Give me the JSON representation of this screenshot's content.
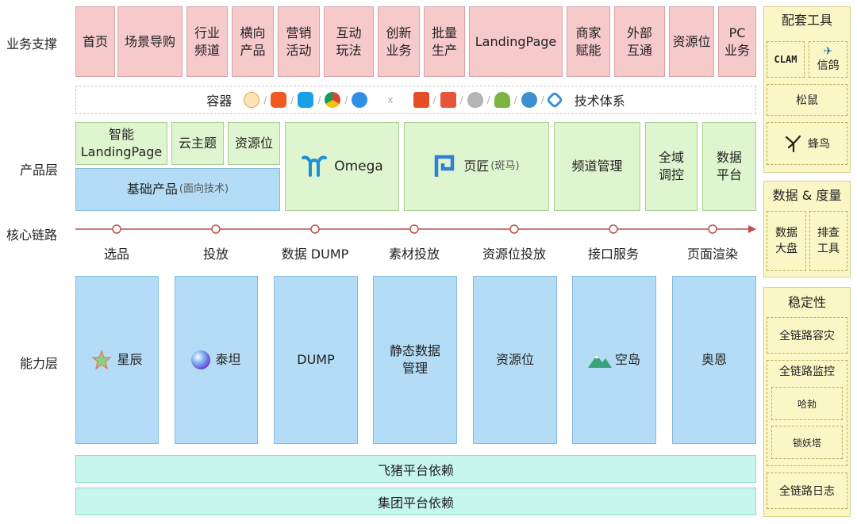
{
  "rows": {
    "business": "业务支撑",
    "product": "产品层",
    "core": "核心链路",
    "capability": "能力层"
  },
  "business_items": [
    "首页",
    "场景导购",
    "行业\n频道",
    "横向\n产品",
    "营销\n活动",
    "互动\n玩法",
    "创新\n业务",
    "批量\n生产",
    "LandingPage",
    "商家\n赋能",
    "外部\n互通",
    "资源位",
    "PC\n业务"
  ],
  "container": {
    "left_label": "容器",
    "right_label": "技术体系",
    "separator": "/",
    "x_mark": "x",
    "icons": [
      "feizhu-icon",
      "taobao-icon",
      "alipay-icon",
      "chrome-icon",
      "safari-icon",
      "html5-icon",
      "react-icon",
      "apple-icon",
      "android-icon",
      "miniapp-icon",
      "weex-icon"
    ]
  },
  "product": {
    "smart_landing": "智能\nLandingPage",
    "cloud_theme": "云主题",
    "resource_slot": "资源位",
    "base_product": "基础产品",
    "base_product_note": "(面向技术)",
    "omega": "Omega",
    "yejiang": "页匠",
    "yejiang_note": "(斑马)",
    "channel_mgmt": "频道管理",
    "global_control": "全域\n调控",
    "data_platform": "数据\n平台"
  },
  "core_steps": [
    "选品",
    "投放",
    "数据 DUMP",
    "素材投放",
    "资源位投放",
    "接口服务",
    "页面渲染"
  ],
  "capability": [
    {
      "label": "星辰",
      "icon": "star-icon"
    },
    {
      "label": "泰坦",
      "icon": "titan-icon"
    },
    {
      "label": "DUMP",
      "icon": ""
    },
    {
      "label": "静态数据\n管理",
      "icon": ""
    },
    {
      "label": "资源位",
      "icon": ""
    },
    {
      "label": "空岛",
      "icon": "mountain-icon"
    },
    {
      "label": "奥恩",
      "icon": ""
    }
  ],
  "deps": {
    "feizhu": "飞猪平台依赖",
    "group": "集团平台依赖"
  },
  "sidebar": {
    "tools_title": "配套工具",
    "clam": "CLAM",
    "xinge": "信鸽",
    "songshu": "松鼠",
    "fengniao": "蜂鸟",
    "data_title": "数据 & 度量",
    "data_board": "数据\n大盘",
    "debug_tool": "排查\n工具",
    "stability_title": "稳定性",
    "disaster": "全链路容灾",
    "monitor": "全链路监控",
    "habo": "哈勃",
    "suoyaota": "锁妖塔",
    "log": "全链路日志"
  },
  "colors": {
    "business_fill": "#f6c9cb",
    "product_fill": "#dff5cf",
    "capability_fill": "#b4dcf6",
    "dependency_fill": "#c6f6ee",
    "sidebar_fill": "#fbf6c6",
    "core_line": "#c0504d"
  }
}
